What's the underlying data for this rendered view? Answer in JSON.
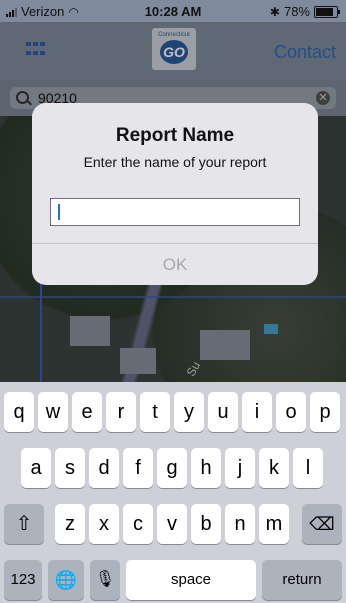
{
  "status_bar": {
    "carrier": "Verizon",
    "time": "10:28 AM",
    "battery": "78%",
    "battery_level": 0.78
  },
  "nav": {
    "contact_label": "Contact",
    "logo_top": "Connecticut",
    "logo_go": "GO"
  },
  "search": {
    "value": "90210"
  },
  "map": {
    "road_label": "Su"
  },
  "alert": {
    "title": "Report Name",
    "message": "Enter the name of your report",
    "input_value": "",
    "ok_label": "OK"
  },
  "keyboard": {
    "row1": [
      "q",
      "w",
      "e",
      "r",
      "t",
      "y",
      "u",
      "i",
      "o",
      "p"
    ],
    "row2": [
      "a",
      "s",
      "d",
      "f",
      "g",
      "h",
      "j",
      "k",
      "l"
    ],
    "row3": [
      "z",
      "x",
      "c",
      "v",
      "b",
      "n",
      "m"
    ],
    "numbers_label": "123",
    "space_label": "space",
    "return_label": "return",
    "shift_icon": "shift-icon",
    "delete_icon": "backspace-icon",
    "globe_icon": "globe-icon",
    "mic_icon": "microphone-icon"
  }
}
